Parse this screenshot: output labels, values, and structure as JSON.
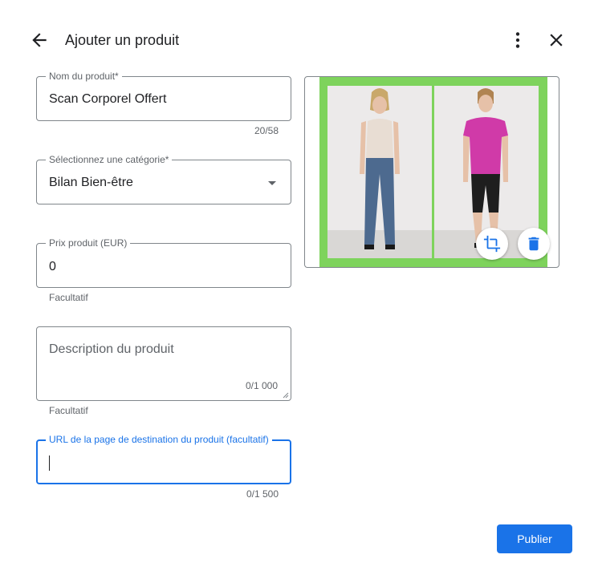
{
  "header": {
    "title": "Ajouter un produit",
    "back_icon": "arrow-back-icon",
    "more_icon": "more-vert-icon",
    "close_icon": "close-icon"
  },
  "form": {
    "name": {
      "label": "Nom du produit*",
      "value": "Scan Corporel Offert",
      "counter": "20/58"
    },
    "category": {
      "label": "Sélectionnez une catégorie*",
      "value": "Bilan Bien-être"
    },
    "price": {
      "label": "Prix produit (EUR)",
      "value": "0",
      "helper": "Facultatif"
    },
    "description": {
      "placeholder": "Description du produit",
      "counter": "0/1 000",
      "helper": "Facultatif"
    },
    "url": {
      "label": "URL de la page de destination du produit (facultatif)",
      "value": "",
      "counter": "0/1 500"
    }
  },
  "image": {
    "crop_icon": "crop-icon",
    "delete_icon": "delete-icon"
  },
  "actions": {
    "publish_label": "Publier"
  },
  "colors": {
    "accent": "#1a73e8",
    "photo_border": "#7ed35c",
    "shirt_left": "#e8ddd3",
    "shirt_right": "#d03aa8"
  }
}
